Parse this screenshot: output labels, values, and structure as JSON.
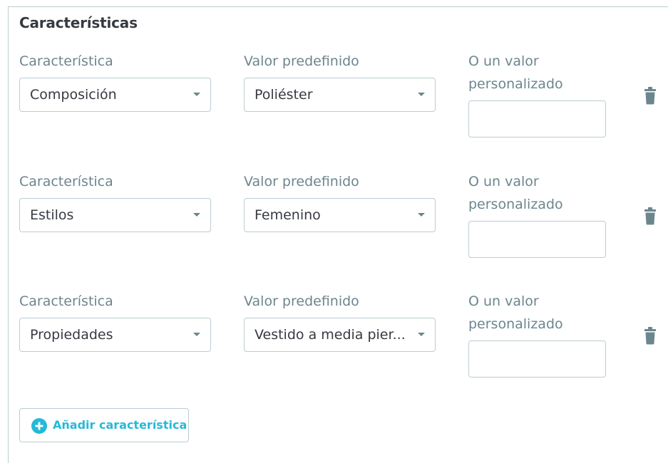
{
  "section": {
    "title": "Características"
  },
  "features": [
    {
      "feature_label": "Característica",
      "feature_value": "Composición",
      "predefined_label": "Valor predefinido",
      "predefined_value": "Poliéster",
      "custom_label": "O un valor personalizado",
      "custom_value": ""
    },
    {
      "feature_label": "Característica",
      "feature_value": "Estilos",
      "predefined_label": "Valor predefinido",
      "predefined_value": "Femenino",
      "custom_label": "O un valor personalizado",
      "custom_value": ""
    },
    {
      "feature_label": "Característica",
      "feature_value": "Propiedades",
      "predefined_label": "Valor predefinido",
      "predefined_value": "Vestido a media pier...",
      "custom_label": "O un valor personalizado",
      "custom_value": ""
    }
  ],
  "actions": {
    "add_feature_label": "Añadir característica"
  },
  "icons": {
    "delete": "trash-icon",
    "add": "plus-circle-icon",
    "dropdown": "caret-down-icon"
  },
  "colors": {
    "label": "#6c868e",
    "text": "#363a41",
    "border": "#bbcdd2",
    "accent": "#25b9d7",
    "trash": "#6c868e"
  }
}
